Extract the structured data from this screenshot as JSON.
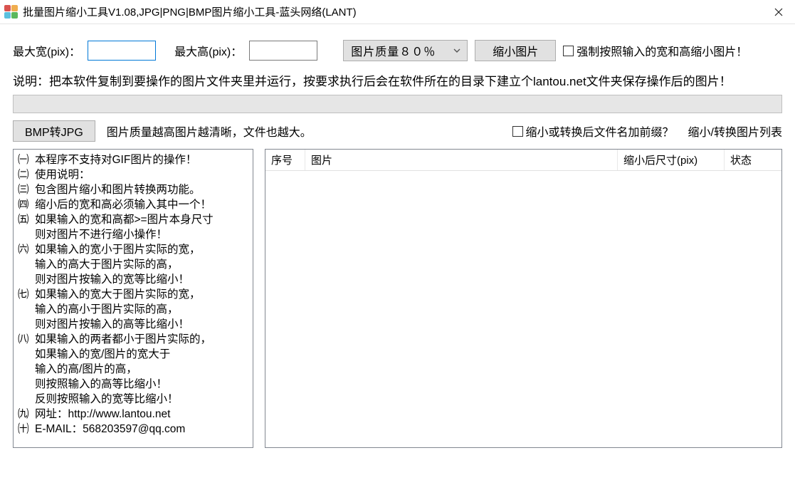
{
  "window": {
    "title": "批量图片缩小工具V1.08,JPG|PNG|BMP图片缩小工具-蓝头网络(LANT)"
  },
  "row1": {
    "max_w_label": "最大宽(pix)：",
    "max_w_value": "",
    "max_h_label": "最大高(pix)：",
    "max_h_value": "",
    "quality_label": "图片质量８０％",
    "shrink_btn": "缩小图片",
    "force_checkbox": "强制按照输入的宽和高缩小图片！"
  },
  "description": "说明：把本软件复制到要操作的图片文件夹里并运行，按要求执行后会在软件所在的目录下建立个lantou.net文件夹保存操作后的图片！",
  "row3": {
    "bmp_btn": "BMP转JPG",
    "hint": "图片质量越高图片越清晰，文件也越大。",
    "prefix_checkbox": "缩小或转换后文件名加前缀？",
    "list_label": "缩小/转换图片列表"
  },
  "help": {
    "items": [
      {
        "b": "㈠",
        "lines": [
          "本程序不支持对GIF图片的操作！"
        ]
      },
      {
        "b": "㈡",
        "lines": [
          "使用说明："
        ]
      },
      {
        "b": "㈢",
        "lines": [
          "包含图片缩小和图片转换两功能。"
        ]
      },
      {
        "b": "㈣",
        "lines": [
          "缩小后的宽和高必须输入其中一个！"
        ]
      },
      {
        "b": "㈤",
        "lines": [
          "如果输入的宽和高都>=图片本身尺寸",
          "则对图片不进行缩小操作！"
        ]
      },
      {
        "b": "㈥",
        "lines": [
          "如果输入的宽小于图片实际的宽，",
          "输入的高大于图片实际的高，",
          "则对图片按输入的宽等比缩小！"
        ]
      },
      {
        "b": "㈦",
        "lines": [
          "如果输入的宽大于图片实际的宽，",
          "输入的高小于图片实际的高，",
          "则对图片按输入的高等比缩小！"
        ]
      },
      {
        "b": "㈧",
        "lines": [
          "如果输入的两者都小于图片实际的，",
          "如果输入的宽/图片的宽大于",
          "输入的高/图片的高，",
          "则按照输入的高等比缩小！",
          "反则按照输入的宽等比缩小！"
        ]
      },
      {
        "b": "㈨",
        "lines": [
          "网址：http://www.lantou.net"
        ]
      },
      {
        "b": "㈩",
        "lines": [
          "E-MAIL：568203597@qq.com"
        ]
      }
    ]
  },
  "grid": {
    "col_idx": "序号",
    "col_img": "图片",
    "col_size": "缩小后尺寸(pix)",
    "col_status": "状态"
  }
}
